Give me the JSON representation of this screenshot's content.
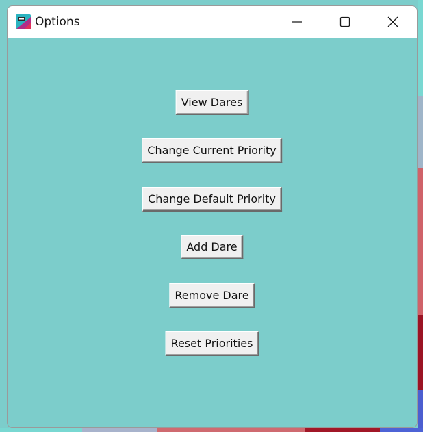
{
  "window": {
    "title": "Options",
    "icon": "app-icon",
    "controls": {
      "minimize": "minimize-icon",
      "maximize": "maximize-icon",
      "close": "close-icon"
    }
  },
  "buttons": [
    {
      "label": "View Dares"
    },
    {
      "label": "Change Current Priority"
    },
    {
      "label": "Change Default Priority"
    },
    {
      "label": "Add Dare"
    },
    {
      "label": "Remove Dare"
    },
    {
      "label": "Reset Priorities"
    }
  ],
  "colors": {
    "background": "#7ccdcb",
    "button_face": "#f0f0f0",
    "title_bar": "#ffffff"
  }
}
